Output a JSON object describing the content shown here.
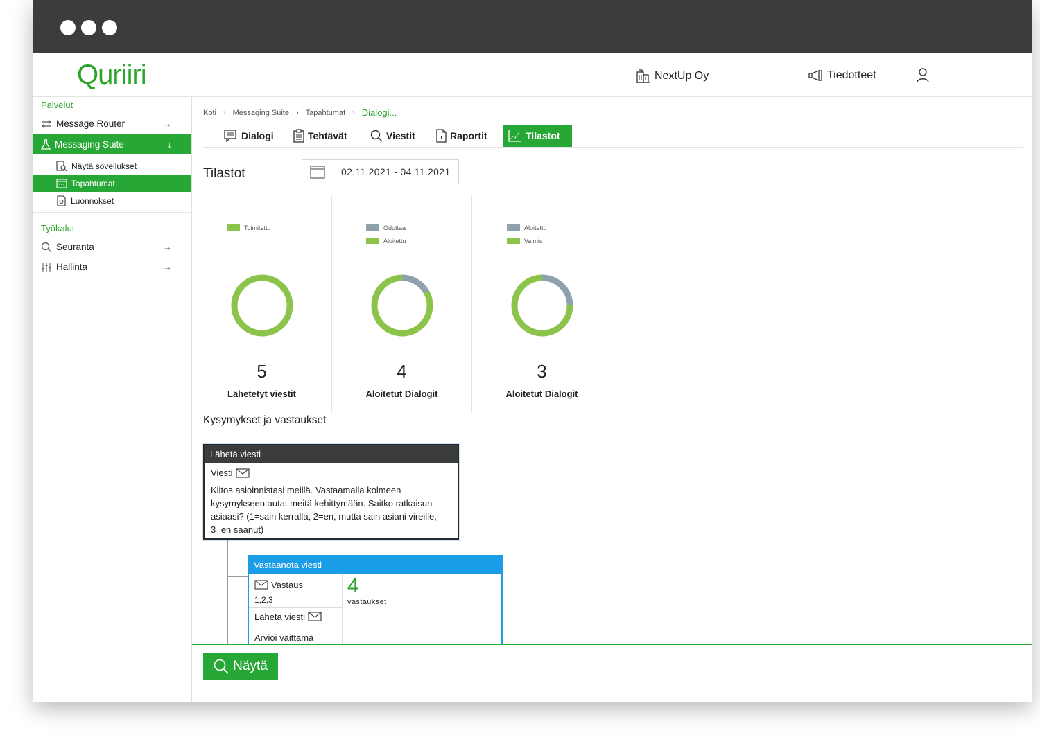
{
  "app": {
    "logo": "Quriiri"
  },
  "header": {
    "company": "NextUp Oy",
    "announcements": "Tiedotteet",
    "icons": [
      "building-icon",
      "megaphone-icon",
      "user-icon"
    ]
  },
  "sidebar": {
    "section_services": "Palvelut",
    "items": [
      {
        "label": "Message Router",
        "icon": "swap-arrows-icon"
      },
      {
        "label": "Messaging Suite",
        "icon": "flask-icon"
      }
    ],
    "subitems": [
      {
        "label": "Näytä sovellukset",
        "icon": "doc-search-icon"
      },
      {
        "label": "Tapahtumat",
        "icon": "calendar-icon"
      },
      {
        "label": "Luonnokset",
        "icon": "draft-icon"
      }
    ],
    "section_tools": "Työkalut",
    "tools": [
      {
        "label": "Seuranta",
        "icon": "search-icon"
      },
      {
        "label": "Hallinta",
        "icon": "sliders-icon"
      }
    ]
  },
  "breadcrumb": [
    "Koti",
    "Messaging Suite",
    "Tapahtumat",
    "Dialogi..."
  ],
  "tabs": [
    {
      "label": "Dialogi",
      "icon": "chat-icon"
    },
    {
      "label": "Tehtävät",
      "icon": "clipboard-icon"
    },
    {
      "label": "Viestit",
      "icon": "search-icon"
    },
    {
      "label": "Raportit",
      "icon": "document-icon"
    },
    {
      "label": "Tilastot",
      "icon": "chart-icon",
      "active": true
    }
  ],
  "stats": {
    "title": "Tilastot",
    "date_range": "02.11.2021 - 04.11.2021"
  },
  "colors": {
    "green": "#8cc34b",
    "grey": "#8fa1ad",
    "accent": "#27a836",
    "blue": "#1b9ce6"
  },
  "chart_data": [
    {
      "type": "pie",
      "series": [
        {
          "name": "Toimitettu",
          "values": [
            1
          ]
        }
      ],
      "categories": [
        "Toimitettu"
      ],
      "values": [
        1
      ],
      "legend": [
        "Toimitettu"
      ],
      "total": "5",
      "label": "Lähetetyt viestit"
    },
    {
      "type": "pie",
      "categories": [
        "Odottaa",
        "Aloitettu"
      ],
      "values": [
        0.17,
        0.83
      ],
      "legend": [
        "Odottaa",
        "Aloitettu"
      ],
      "total": "4",
      "label": "Aloitetut Dialogit"
    },
    {
      "type": "pie",
      "categories": [
        "Aloitettu",
        "Valmis"
      ],
      "values": [
        0.25,
        0.75
      ],
      "legend": [
        "Aloitettu",
        "Valmis"
      ],
      "total": "3",
      "label": "Aloitetut Dialogit"
    }
  ],
  "qa": {
    "title": "Kysymykset ja vastaukset",
    "send_node": {
      "header": "Lähetä viesti",
      "type": "Viesti",
      "text": "Kiitos asioinnistasi meillä. Vastaamalla kolmeen kysymykseen autat meitä kehittymään. Saitko ratkaisun asiaasi? (1=sain kerralla, 2=en, mutta sain asiani vireille, 3=en saanut)"
    },
    "receive_node": {
      "header": "Vastaanota viesti",
      "answer_label": "Vastaus",
      "answer_value": "1,2,3",
      "send_label": "Lähetä viesti",
      "evaluate_label": "Arvioi väittämä",
      "count": "4",
      "count_label": "vastaukset"
    }
  },
  "show_button": "Näytä"
}
